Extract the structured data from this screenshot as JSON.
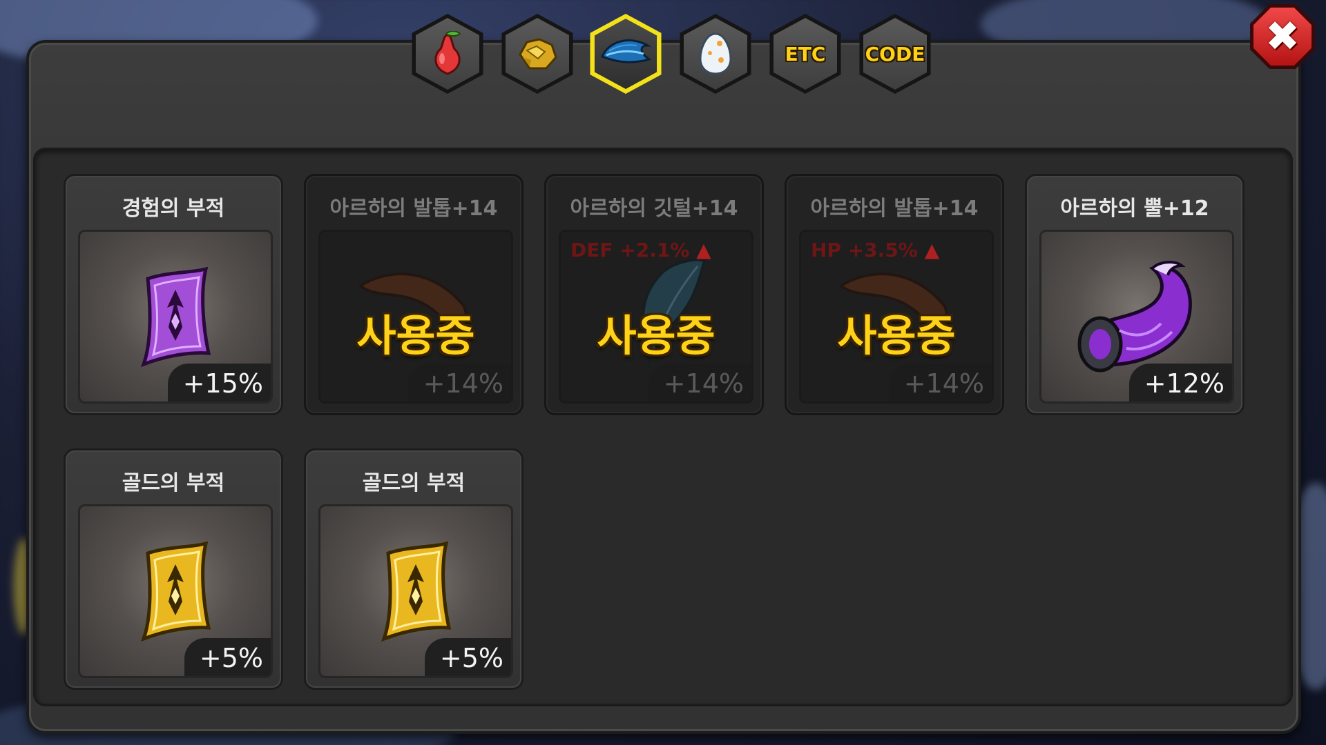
{
  "tabs": [
    {
      "kind": "icon",
      "icon": "pear-fruit-icon",
      "active": false
    },
    {
      "kind": "icon",
      "icon": "gold-ore-icon",
      "active": false
    },
    {
      "kind": "icon",
      "icon": "blue-feather-icon",
      "active": true
    },
    {
      "kind": "icon",
      "icon": "egg-icon",
      "active": false
    },
    {
      "kind": "text",
      "label": "ETC",
      "active": false
    },
    {
      "kind": "text",
      "label": "CODE",
      "active": false
    }
  ],
  "close_label": "✖",
  "items": [
    {
      "title": "경험의 부적",
      "bonus": "+15%",
      "in_use": false,
      "icon": "purple-talisman-icon"
    },
    {
      "title": "아르하의 발톱+14",
      "bonus": "+14%",
      "in_use": true,
      "in_use_label": "사용중",
      "stat": "",
      "icon": "claw-icon"
    },
    {
      "title": "아르하의 깃털+14",
      "bonus": "+14%",
      "in_use": true,
      "in_use_label": "사용중",
      "stat": "DEF +2.1%",
      "icon": "feather-icon"
    },
    {
      "title": "아르하의 발톱+14",
      "bonus": "+14%",
      "in_use": true,
      "in_use_label": "사용중",
      "stat": "HP +3.5%",
      "icon": "claw-icon"
    },
    {
      "title": "아르하의 뿔+12",
      "bonus": "+12%",
      "in_use": false,
      "icon": "purple-horn-icon"
    },
    {
      "title": "골드의 부적",
      "bonus": "+5%",
      "in_use": false,
      "icon": "gold-talisman-icon"
    },
    {
      "title": "골드의 부적",
      "bonus": "+5%",
      "in_use": false,
      "icon": "gold-talisman-icon"
    }
  ],
  "colors": {
    "active_tab_border": "#f3e21a",
    "in_use_text": "#ffd21a",
    "close_button": "#d42a2a",
    "stat_up": "#b02020"
  }
}
